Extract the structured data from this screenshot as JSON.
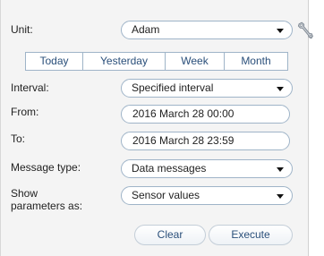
{
  "form": {
    "unit_label": "Unit:",
    "unit_value": "Adam",
    "interval_label": "Interval:",
    "interval_value": "Specified interval",
    "from_label": "From:",
    "from_value": "2016 March 28 00:00",
    "to_label": "To:",
    "to_value": "2016 March 28 23:59",
    "message_type_label": "Message type:",
    "message_type_value": "Data messages",
    "show_params_label_line1": "Show",
    "show_params_label_line2": "parameters as:",
    "show_params_value": "Sensor values"
  },
  "quick_tabs": [
    "Today",
    "Yesterday",
    "Week",
    "Month"
  ],
  "buttons": {
    "clear": "Clear",
    "execute": "Execute"
  },
  "icons": {
    "unit_settings": "wrench-icon",
    "dropdown": "chevron-down-icon"
  },
  "colors": {
    "accent_text": "#2a4f7a",
    "border": "#9fb4c8",
    "panel_bg": "#f4f4f4"
  }
}
